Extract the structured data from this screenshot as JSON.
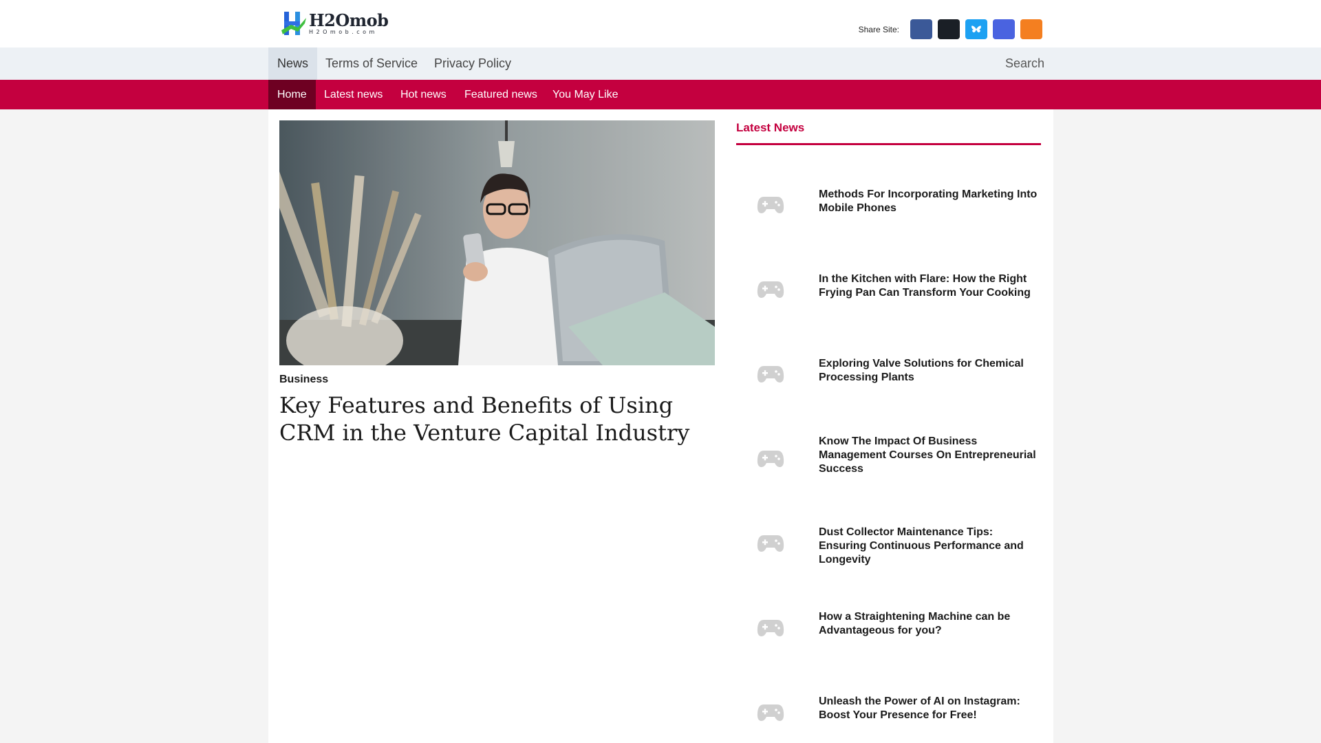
{
  "brand": {
    "name": "H2Omob",
    "tagline": "H2Omob.com"
  },
  "share": {
    "label": "Share Site:",
    "buttons": [
      {
        "name": "facebook",
        "color": "#3b5998"
      },
      {
        "name": "x",
        "color": "#1a1f26"
      },
      {
        "name": "bluesky",
        "color": "#1da1f2"
      },
      {
        "name": "discord",
        "color": "#4a63e0"
      },
      {
        "name": "rss",
        "color": "#f47f20"
      }
    ]
  },
  "nav": {
    "items": [
      "News",
      "Terms of Service",
      "Privacy Policy"
    ],
    "search": "Search"
  },
  "subnav": {
    "items": [
      "Home",
      "Latest news",
      "Hot news",
      "Featured news",
      "You May Like"
    ]
  },
  "article": {
    "category": "Business",
    "title": "Key Features and Benefits of Using CRM in the Venture Capital Industry"
  },
  "sidebar": {
    "title": "Latest News",
    "items": [
      "Methods For Incorporating Marketing Into Mobile Phones",
      "In the Kitchen with Flare: How the Right Frying Pan Can Transform Your Cooking",
      "Exploring Valve Solutions for Chemical Processing Plants",
      "Know The Impact Of Business Management Courses On Entrepreneurial Success",
      "Dust Collector Maintenance Tips: Ensuring Continuous Performance and Longevity",
      "How a Straightening Machine can be Advantageous for you?",
      "Unleash the Power of AI on Instagram: Boost Your Presence for Free!"
    ]
  },
  "colors": {
    "accent": "#c4003f",
    "accent_dark": "#6e0022",
    "nav_bg": "#edf1f5"
  }
}
